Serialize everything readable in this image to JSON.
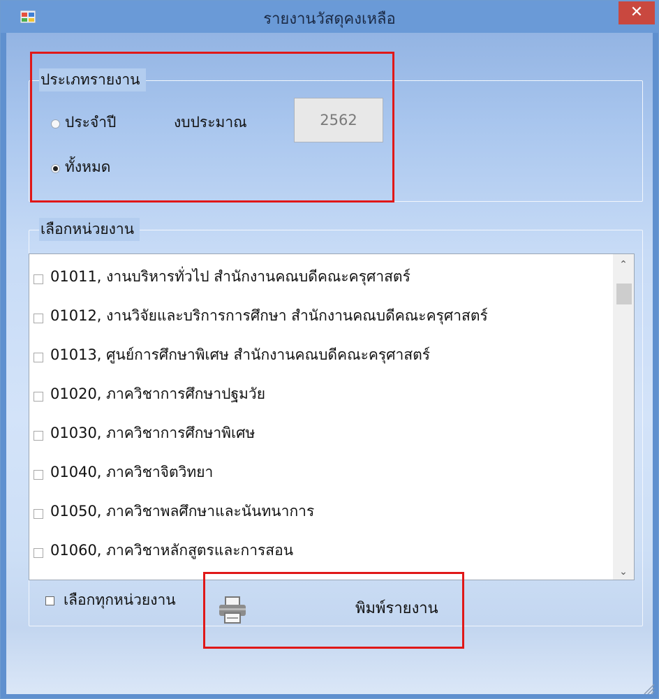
{
  "window": {
    "title": "รายงานวัสดุคงเหลือ",
    "close_glyph": "✕",
    "app_icon": "application-icon"
  },
  "report_type": {
    "group_title": "ประเภทรายงาน",
    "options": [
      {
        "label": "ประจำปี",
        "selected": false
      },
      {
        "label": "ทั้งหมด",
        "selected": true
      }
    ],
    "budget_label": "งบประมาณ",
    "budget_year": "2562"
  },
  "units": {
    "group_title": "เลือกหน่วยงาน",
    "items": [
      {
        "label": "01011, งานบริหารทั่วไป สำนักงานคณบดีคณะครุศาสตร์",
        "checked": false
      },
      {
        "label": "01012, งานวิจัยและบริการการศึกษา สำนักงานคณบดีคณะครุศาสตร์",
        "checked": false
      },
      {
        "label": "01013, ศูนย์การศึกษาพิเศษ สำนักงานคณบดีคณะครุศาสตร์",
        "checked": false
      },
      {
        "label": "01020, ภาควิชาการศึกษาปฐมวัย",
        "checked": false
      },
      {
        "label": "01030, ภาควิชาการศึกษาพิเศษ",
        "checked": false
      },
      {
        "label": "01040, ภาควิชาจิตวิทยา",
        "checked": false
      },
      {
        "label": "01050, ภาควิชาพลศึกษาและนันทนาการ",
        "checked": false
      },
      {
        "label": "01060, ภาควิชาหลักสูตรและการสอน",
        "checked": false
      }
    ],
    "select_all_label": "เลือกทุกหน่วยงาน",
    "select_all_checked": false
  },
  "print_button": {
    "label": "พิมพ์รายงาน",
    "icon": "printer-icon"
  },
  "colors": {
    "highlight": "#e01818",
    "close_button": "#c9483f",
    "titlebar": "#6a9ad7"
  }
}
